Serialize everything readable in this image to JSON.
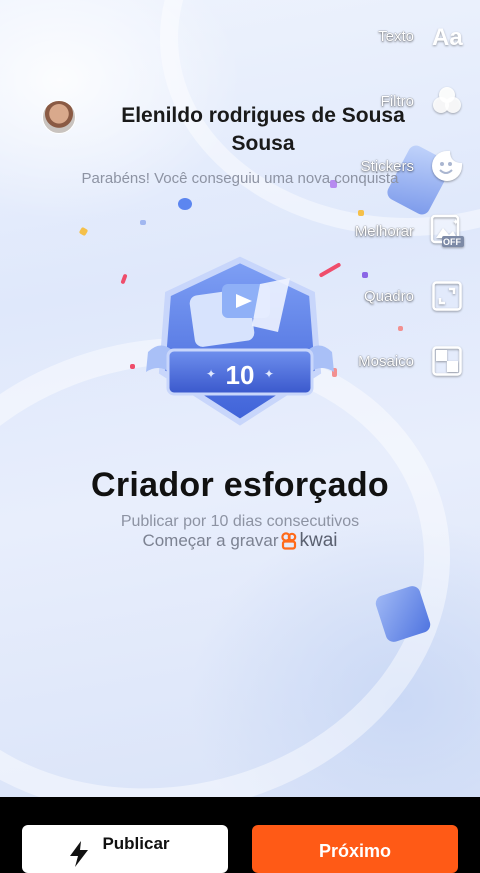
{
  "profile": {
    "username": "Elenildo rodrigues de Sousa Sousa",
    "congrats_text": "Parabéns! Você conseguiu uma nova conquista"
  },
  "achievement": {
    "badge_number": "10",
    "title": "Criador esforçado",
    "description": "Publicar por 10 dias consecutivos",
    "start_text": "Começar a gravar",
    "brand_name": "kwai"
  },
  "edit_rail": [
    {
      "label": "Texto",
      "icon": "text-aa-icon"
    },
    {
      "label": "Filtro",
      "icon": "filter-circles-icon"
    },
    {
      "label": "Stickers",
      "icon": "sticker-smile-icon"
    },
    {
      "label": "Melhorar",
      "icon": "enhance-off-icon"
    },
    {
      "label": "Quadro",
      "icon": "frame-expand-icon"
    },
    {
      "label": "Mosaico",
      "icon": "mosaic-grid-icon"
    }
  ],
  "actions": {
    "publish_label": "Publicar",
    "next_label": "Próximo"
  },
  "colors": {
    "accent_orange": "#ff5a16",
    "badge_blue": "#4b74e6",
    "kwai_orange": "#ff6a1a"
  }
}
